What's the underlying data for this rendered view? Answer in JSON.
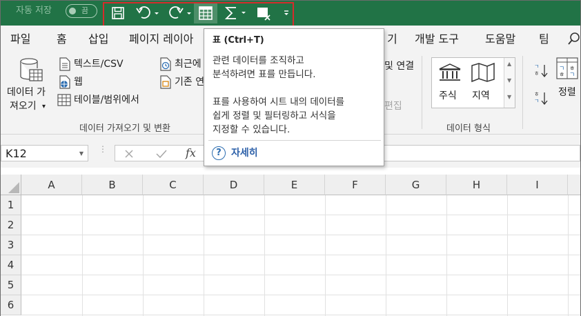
{
  "qat": {
    "autosave_label": "자동 저장",
    "autosave_toggle": "끔",
    "buttons": [
      "save-icon",
      "undo-icon",
      "redo-icon",
      "table-icon",
      "autosum-icon",
      "clear-filter-icon",
      "customize-qat-icon"
    ]
  },
  "tabs": [
    "파일",
    "홈",
    "삽입",
    "페이지 레이아",
    "기",
    "개발 도구",
    "도움말",
    "팀"
  ],
  "ribbon": {
    "get_data": {
      "big_button_line1": "데이터 가",
      "big_button_line2": "져오기",
      "caret": "▾",
      "items": [
        "텍스트/CSV",
        "웹",
        "테이블/범위에서"
      ],
      "recent_items": [
        "최근에",
        "기존 연"
      ],
      "group_label": "데이터 가져오기 및 변환"
    },
    "connections": {
      "item": "및 연결",
      "dim_item": "편집"
    },
    "data_types": {
      "items": [
        "주식",
        "지역"
      ],
      "group_label": "데이터 형식"
    },
    "sort": {
      "label": "정렬"
    }
  },
  "formula_bar": {
    "name_box": "K12",
    "fx": "fx"
  },
  "grid": {
    "columns": [
      "A",
      "B",
      "C",
      "D",
      "E",
      "F",
      "G",
      "H",
      "I"
    ],
    "rows": [
      "1",
      "2",
      "3",
      "4",
      "5",
      "6"
    ]
  },
  "tooltip": {
    "title": "표 (Ctrl+T)",
    "lines": [
      "관련 데이터를 조직하고",
      "분석하려면 표를 만듭니다.",
      "표를 사용하여 시트 내의 데이터를",
      "쉽게 정렬 및 필터링하고 서식을",
      "지정할 수 있습니다."
    ],
    "help_link": "자세히"
  },
  "colors": {
    "title_bar": "#217346",
    "highlight_box": "#d62b2b",
    "ribbon_bg": "#f3f3f3",
    "link": "#2b5fa8"
  }
}
